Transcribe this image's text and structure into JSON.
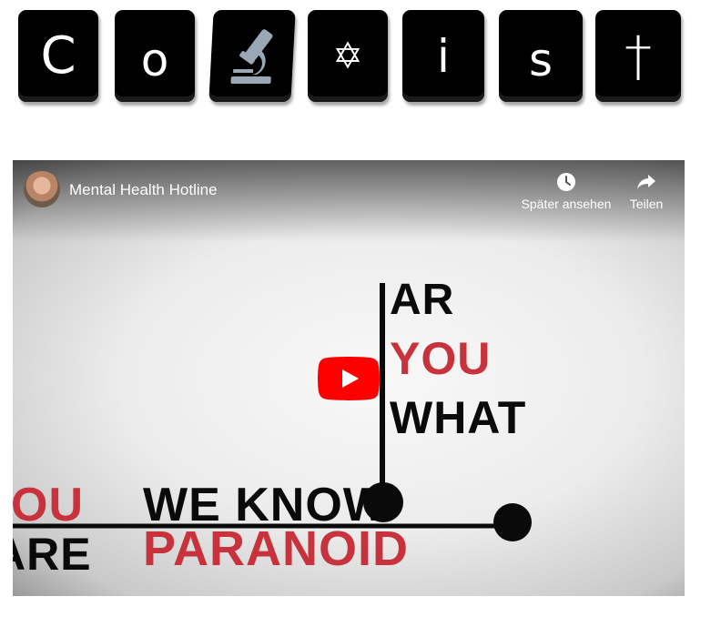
{
  "tiles": [
    {
      "name": "letter-c",
      "text": "C"
    },
    {
      "name": "letter-o",
      "text": "o"
    },
    {
      "name": "microscope-icon",
      "icon": "microscope"
    },
    {
      "name": "star-of-david-icon",
      "text": "✡"
    },
    {
      "name": "letter-i",
      "text": "i"
    },
    {
      "name": "letter-s",
      "text": "s"
    },
    {
      "name": "cross-icon",
      "text": "†"
    }
  ],
  "video": {
    "title": "Mental Health Hotline",
    "watch_later_label": "Später ansehen",
    "share_label": "Teilen",
    "play_icon": "youtube-play-icon",
    "brand_red": "#ff0000",
    "thumbnail_words": {
      "ar": "AR",
      "you_upper": "YOU",
      "what": "WHAT",
      "we_know": "WE KNOW",
      "you_left": "OU",
      "are_left": "ARE",
      "paranoid": "PARANOID"
    },
    "colors": {
      "text_black": "#0a0a0a",
      "text_red": "#c8323c"
    }
  }
}
